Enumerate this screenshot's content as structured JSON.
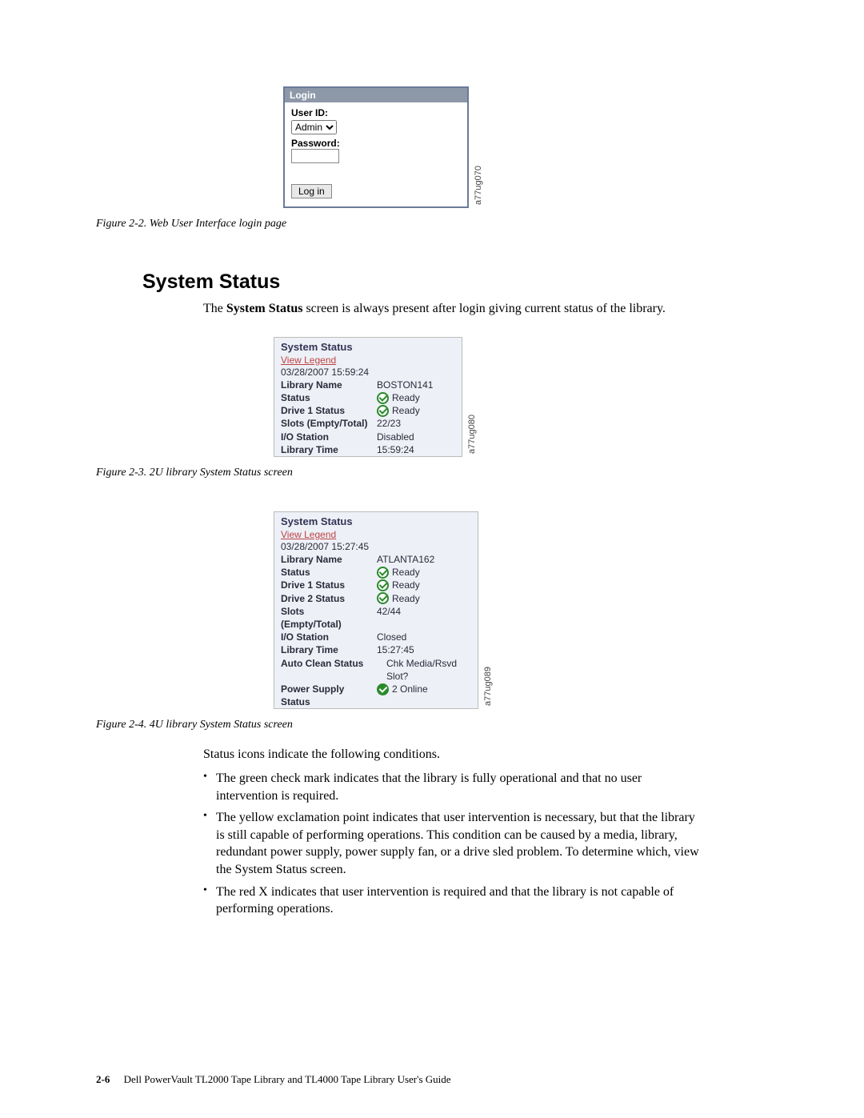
{
  "login": {
    "header": "Login",
    "user_id_label": "User ID:",
    "user_id_value": "Admin",
    "password_label": "Password:",
    "button": "Log in",
    "sidecode": "a77ug070"
  },
  "caption1": "Figure 2-2. Web User Interface login page",
  "heading": "System Status",
  "intro_pre": "The ",
  "intro_bold": "System Status",
  "intro_post": " screen is always present after login giving current status of the library.",
  "status2u": {
    "title": "System Status",
    "view_legend": "View Legend",
    "timestamp": "03/28/2007 15:59:24",
    "rows": {
      "lib_name_l": "Library Name",
      "lib_name_v": "BOSTON141",
      "status_l": "Status",
      "status_v": "Ready",
      "d1_l": "Drive 1 Status",
      "d1_v": "Ready",
      "slots_l": "Slots (Empty/Total)",
      "slots_v": "22/23",
      "io_l": "I/O Station",
      "io_v": "Disabled",
      "time_l": "Library Time",
      "time_v": "15:59:24"
    },
    "sidecode": "a77ug080"
  },
  "caption2": "Figure 2-3. 2U library System Status screen",
  "status4u": {
    "title": "System Status",
    "view_legend": "View Legend",
    "timestamp": "03/28/2007 15:27:45",
    "rows": {
      "lib_name_l": "Library Name",
      "lib_name_v": "ATLANTA162",
      "status_l": "Status",
      "status_v": "Ready",
      "d1_l": "Drive 1 Status",
      "d1_v": "Ready",
      "d2_l": "Drive 2 Status",
      "d2_v": "Ready",
      "slots_l1": "Slots",
      "slots_v": "42/44",
      "slots_l2": "(Empty/Total)",
      "io_l": "I/O Station",
      "io_v": "Closed",
      "time_l": "Library Time",
      "time_v": "15:27:45",
      "auto_l": "Auto Clean Status",
      "auto_v1": "Chk Media/Rsvd",
      "auto_v2": "Slot?",
      "ps_l1": "Power Supply",
      "ps_v": "2 Online",
      "ps_l2": "Status"
    },
    "sidecode": "a77ug089"
  },
  "caption3": "Figure 2-4. 4U library System Status screen",
  "after_text": "Status icons indicate the following conditions.",
  "bullets": [
    "The green check mark indicates that the library is fully operational and that no user intervention is required.",
    "The yellow exclamation point indicates that user intervention is necessary, but that the library is still capable of performing operations. This condition can be caused by a media, library, redundant power supply, power supply fan, or a drive sled problem. To determine which, view the System Status screen.",
    "The red X indicates that user intervention is required and that the library is not capable of performing operations."
  ],
  "footer": {
    "pagenum": "2-6",
    "text": "Dell PowerVault TL2000 Tape Library and TL4000 Tape Library User's Guide"
  }
}
